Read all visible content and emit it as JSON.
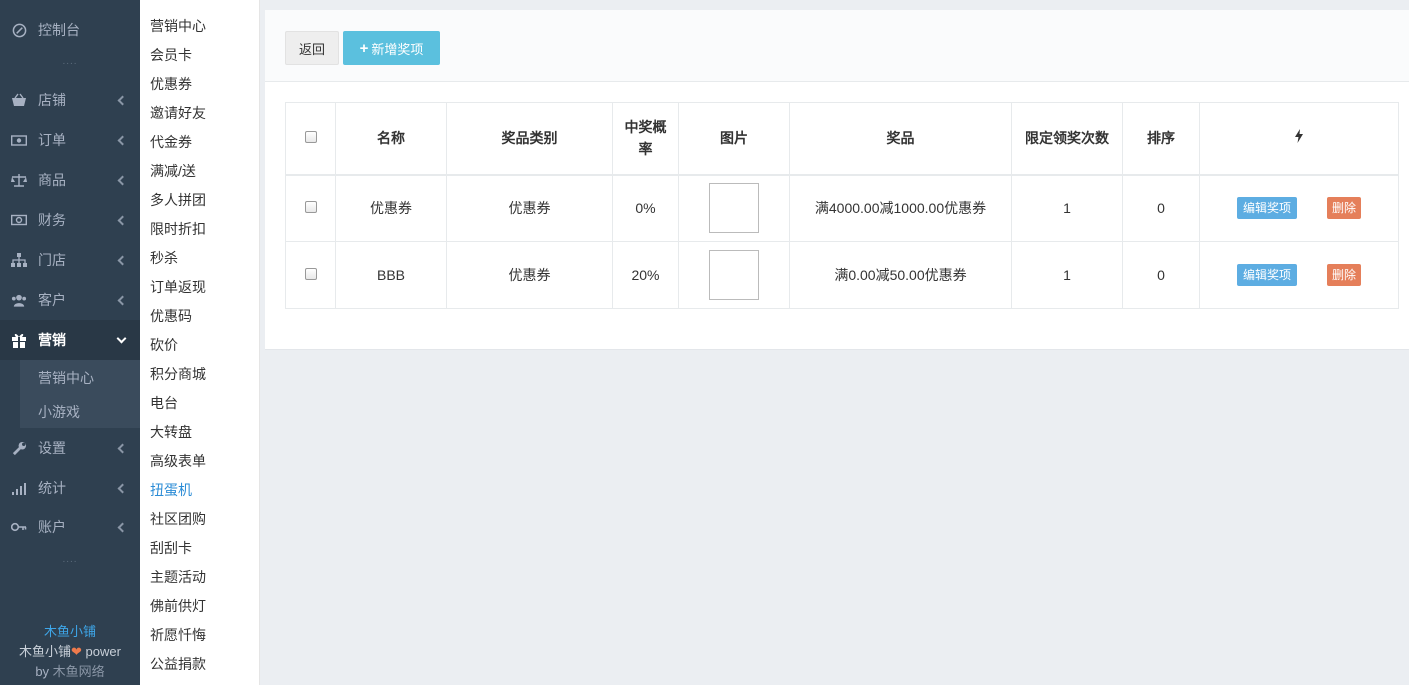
{
  "nav": {
    "dashboard": "控制台",
    "items": [
      {
        "label": "店铺",
        "icon": "basket-icon"
      },
      {
        "label": "订单",
        "icon": "money-icon"
      },
      {
        "label": "商品",
        "icon": "scale-icon"
      },
      {
        "label": "财务",
        "icon": "cash-icon"
      },
      {
        "label": "门店",
        "icon": "sitemap-icon"
      },
      {
        "label": "客户",
        "icon": "users-icon"
      }
    ],
    "marketing": "营销",
    "sub_items": [
      "营销中心",
      "小游戏"
    ],
    "lower_items": [
      {
        "label": "设置",
        "icon": "wrench-icon"
      },
      {
        "label": "统计",
        "icon": "signal-icon"
      },
      {
        "label": "账户",
        "icon": "key-icon"
      }
    ],
    "dots": "....",
    "footer": {
      "brand": "木鱼小铺",
      "power_prefix": "木鱼小铺",
      "power_suffix": " power",
      "by_prefix": "by ",
      "company": "木鱼网络"
    }
  },
  "menu2": {
    "items": [
      "营销中心",
      "会员卡",
      "优惠券",
      "邀请好友",
      "代金券",
      "满减/送",
      "多人拼团",
      "限时折扣",
      "秒杀",
      "订单返现",
      "优惠码",
      "砍价",
      "积分商城",
      "电台",
      "大转盘",
      "高级表单",
      "扭蛋机",
      "社区团购",
      "刮刮卡",
      "主题活动",
      "佛前供灯",
      "祈愿忏悔",
      "公益捐款"
    ],
    "active_index": 16
  },
  "toolbar": {
    "back_label": "返回",
    "add_label": "新增奖项"
  },
  "table": {
    "headers": [
      "名称",
      "奖品类别",
      "中奖概率",
      "图片",
      "奖品",
      "限定领奖次数",
      "排序"
    ],
    "rows": [
      {
        "name": "优惠券",
        "category": "优惠券",
        "probability": "0%",
        "prize": "满4000.00减1000.00优惠券",
        "limit": "1",
        "sort": "0"
      },
      {
        "name": "BBB",
        "category": "优惠券",
        "probability": "20%",
        "prize": "满0.00减50.00优惠券",
        "limit": "1",
        "sort": "0"
      }
    ],
    "edit_label": "编辑奖项",
    "delete_label": "删除"
  }
}
